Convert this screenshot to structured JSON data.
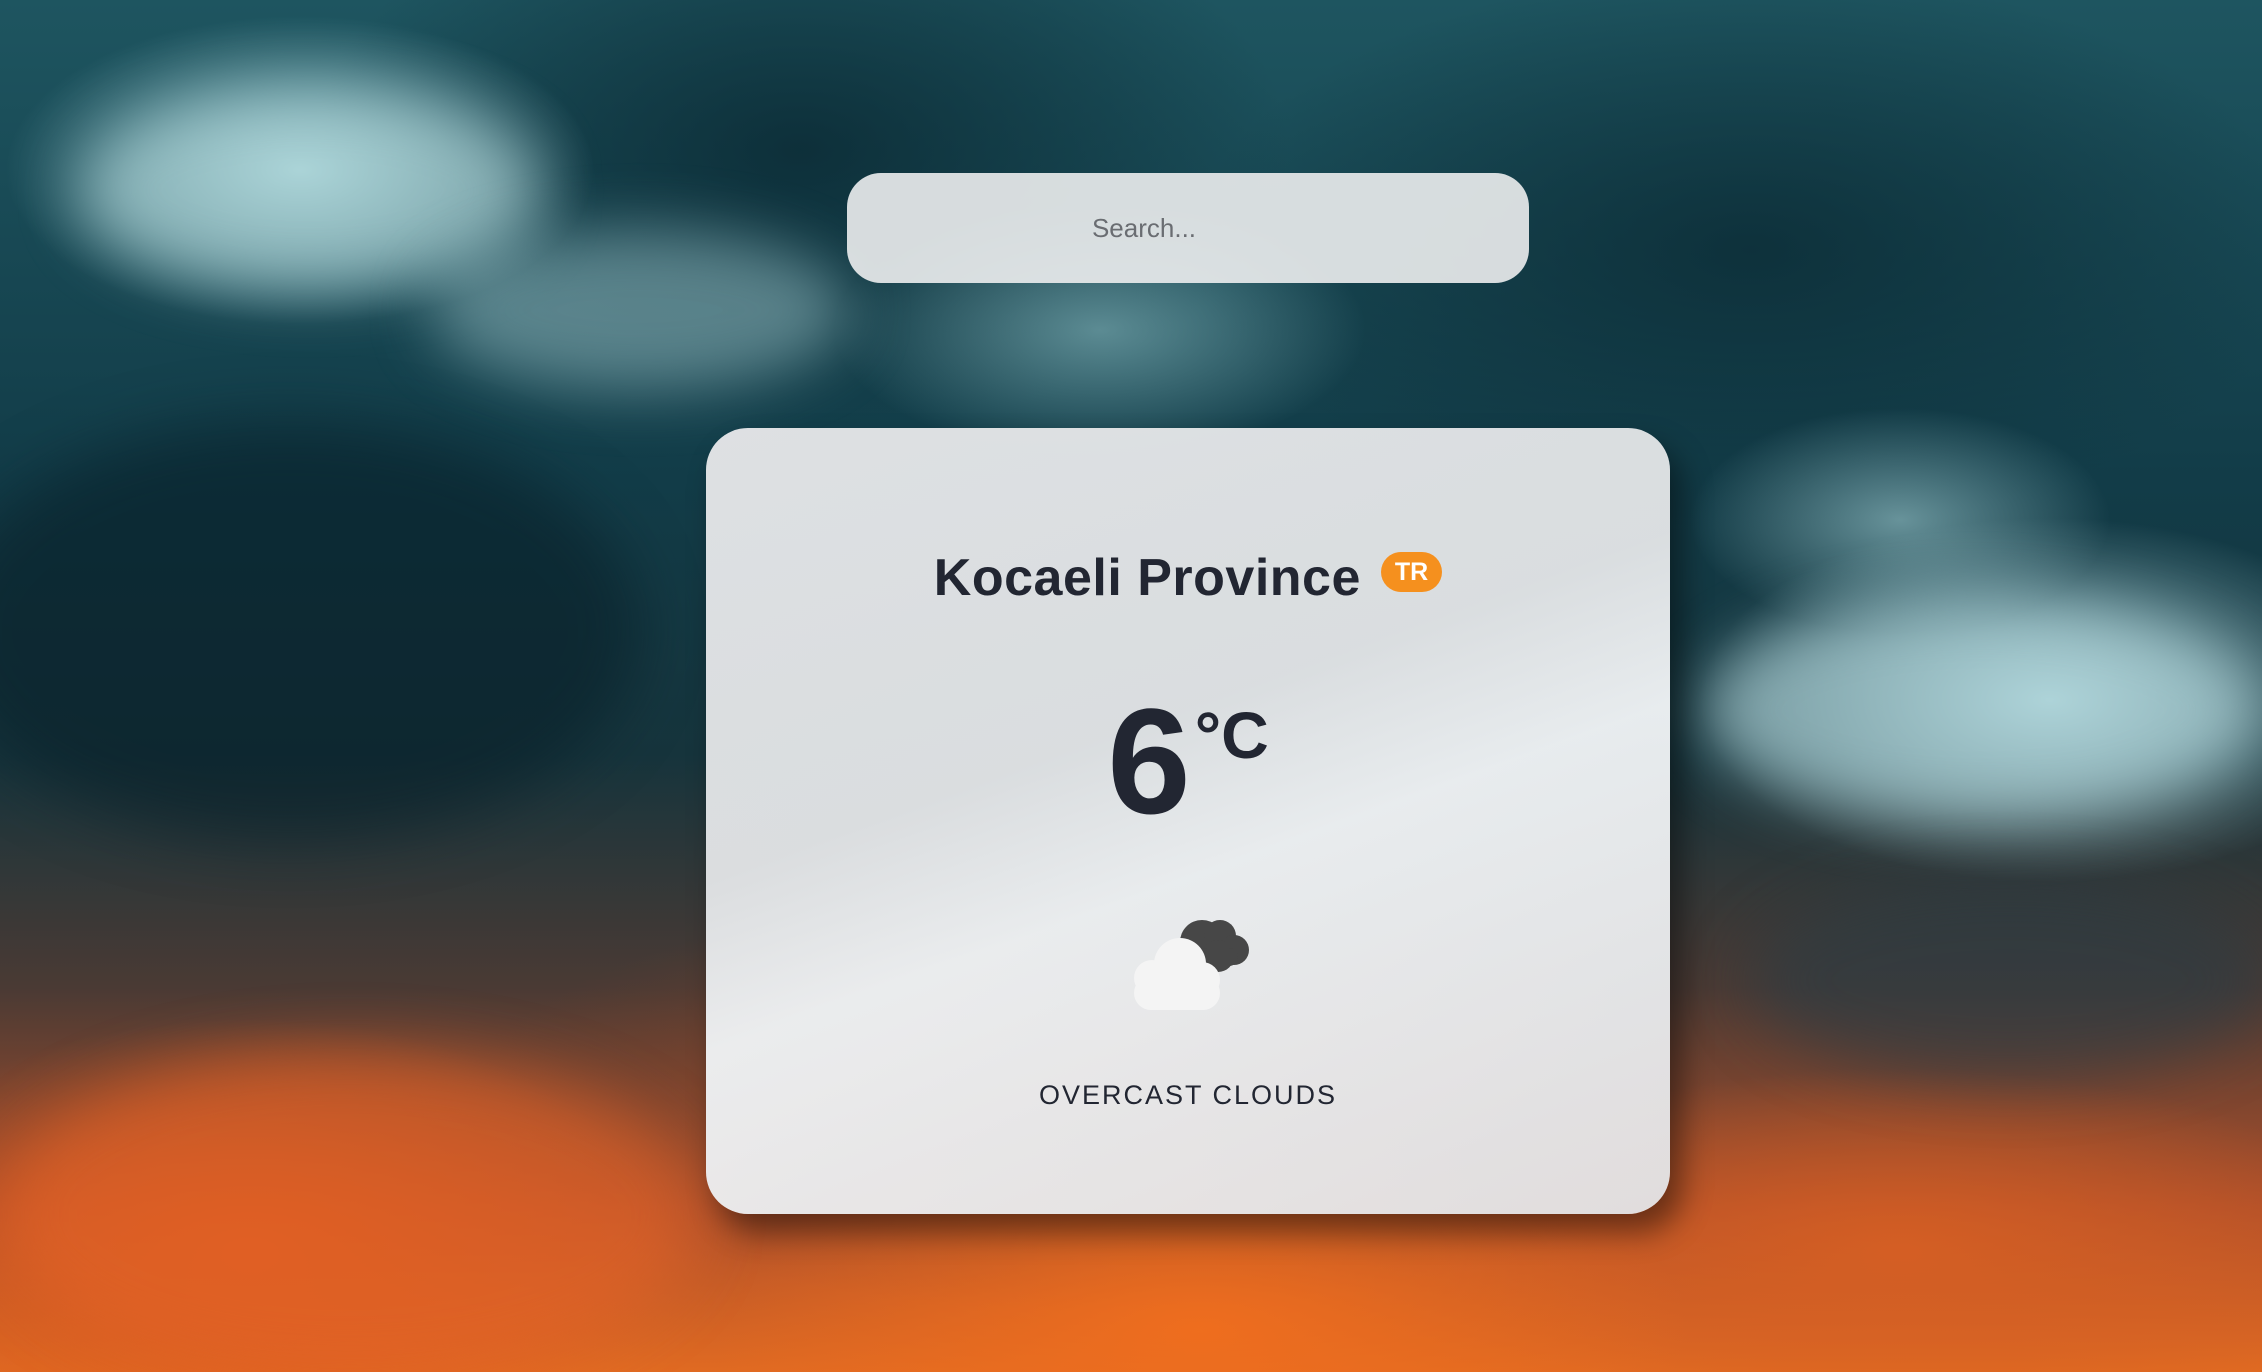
{
  "search": {
    "placeholder": "Search...",
    "value": ""
  },
  "weather": {
    "city": "Kocaeli Province",
    "country_code": "TR",
    "temperature": "6",
    "unit": "°C",
    "icon": "overcast-clouds-icon",
    "description": "OVERCAST CLOUDS"
  },
  "colors": {
    "badge": "#f5901e",
    "text": "#222632"
  }
}
